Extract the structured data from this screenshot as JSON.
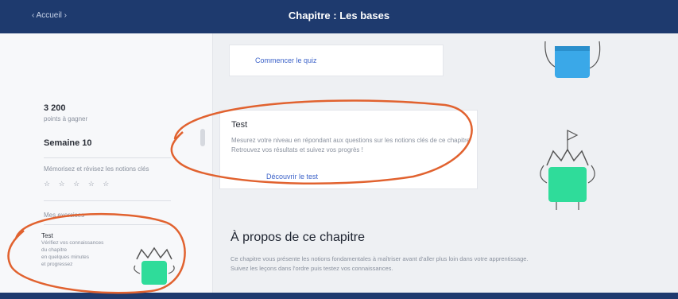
{
  "header": {
    "back_label": "‹ Accueil ›",
    "title": "Chapitre : Les bases"
  },
  "sidebar": {
    "points_value": "3 200",
    "points_caption": "points à gagner",
    "week_label": "Semaine 10",
    "week_subtitle": "Mémorisez et révisez les notions clés",
    "rating_placeholder": "☆ ☆ ☆ ☆ ☆",
    "section_label": "Mes exercices",
    "test_card": {
      "title": "Test",
      "text_lines": [
        "Vérifiez vos connaissances",
        "du chapitre",
        "en quelques minutes",
        "et progressez"
      ]
    }
  },
  "main": {
    "top_link": "Commencer le quiz",
    "test_card": {
      "title": "Test",
      "text_line1": "Mesurez votre niveau en répondant aux questions sur les notions clés de ce chapitre.",
      "text_line2": "Retrouvez vos résultats et suivez vos progrès !",
      "link": "Découvrir le test"
    },
    "about_title": "À propos de ce chapitre",
    "about_line1": "Ce chapitre vous présente les notions fondamentales à maîtriser avant d'aller plus loin dans votre apprentissage.",
    "about_line2": "Suivez les leçons dans l'ordre puis testez vos connaissances."
  },
  "colors": {
    "header": "#1e3a6e",
    "accent_blue": "#3aa8e8",
    "accent_green": "#2fdc9a",
    "annotation_orange": "#e1622f",
    "link": "#3d63c9"
  },
  "icons": [
    "crown-mascot-icon",
    "flag-mascot-icon",
    "blue-mascot-icon"
  ]
}
